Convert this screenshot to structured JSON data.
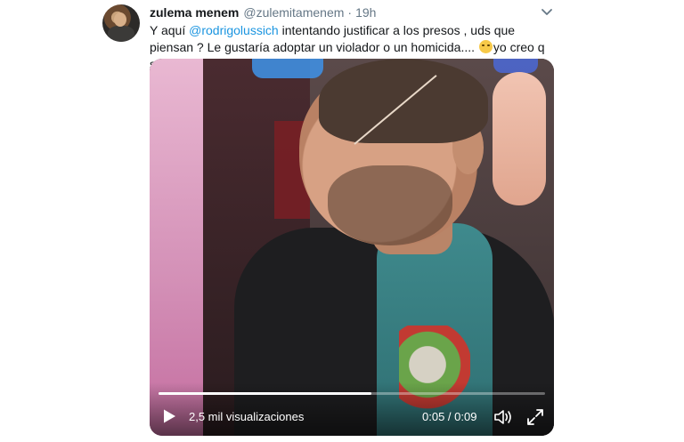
{
  "tweet": {
    "display_name": "zulema menem",
    "handle": "@zulemitamenem",
    "separator": "·",
    "time": "19h",
    "text_before": "Y aquí ",
    "mention": "@rodrigolussich",
    "text_after": " intentando justificar a los presos , uds que piensan ? Le gustaría adoptar un violador o un homicida.... ",
    "text_end": "yo creo q se....",
    "emoji": "upside-down-face"
  },
  "video": {
    "views": "2,5 mil visualizaciones",
    "timecode": "0:05 / 0:09",
    "progress": 0.55
  },
  "icons": {
    "play": "play-icon",
    "volume": "volume-icon",
    "fullscreen": "fullscreen-icon",
    "caret": "chevron-down-icon"
  },
  "colors": {
    "link": "#1b95e0",
    "secondary_text": "#657786",
    "primary_text": "#14171a"
  }
}
